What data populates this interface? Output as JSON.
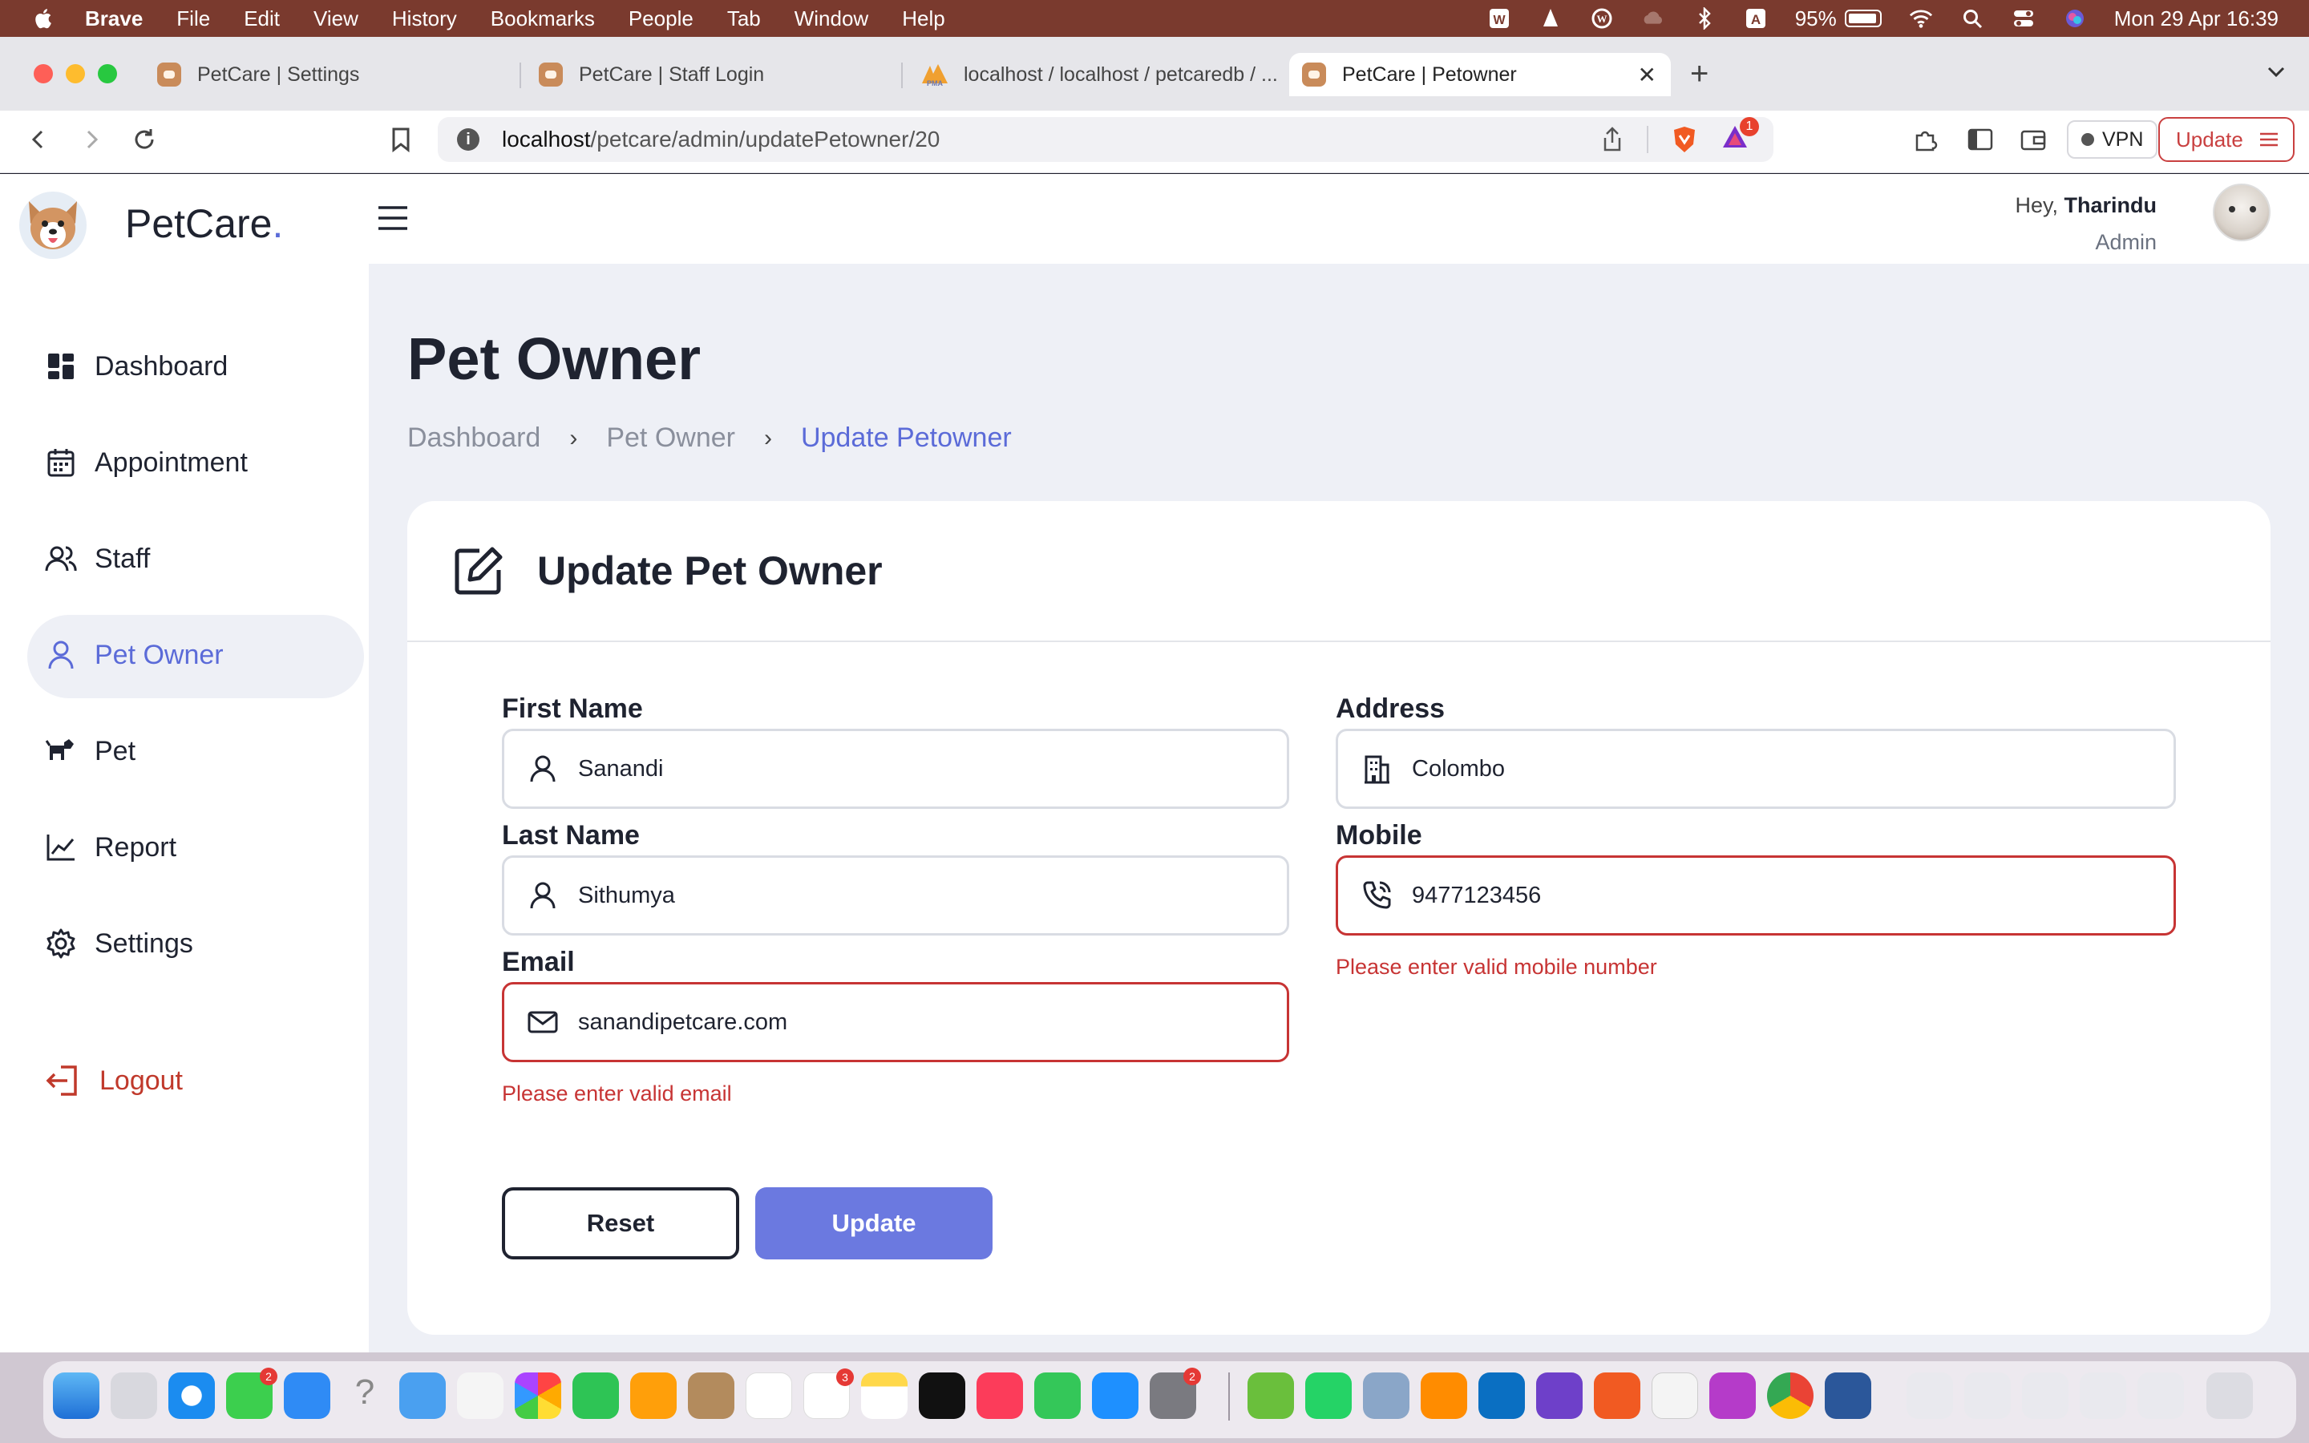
{
  "menubar": {
    "app": "Brave",
    "items": [
      "File",
      "Edit",
      "View",
      "History",
      "Bookmarks",
      "People",
      "Tab",
      "Window",
      "Help"
    ],
    "battery": "95%",
    "datetime": "Mon 29 Apr  16:39"
  },
  "browser": {
    "tabs": [
      {
        "title": "PetCare | Settings"
      },
      {
        "title": "PetCare | Staff Login"
      },
      {
        "title": "localhost / localhost / petcaredb / ..."
      },
      {
        "title": "PetCare | Petowner"
      }
    ],
    "url_host": "localhost",
    "url_path": "/petcare/admin/updatePetowner/20",
    "vpn_label": "VPN",
    "update_label": "Update",
    "notification_count": "1"
  },
  "app": {
    "brand": "PetCare",
    "brand_dot": ".",
    "user_greeting": "Hey,",
    "user_name": "Tharindu",
    "user_role": "Admin",
    "nav": [
      {
        "label": "Dashboard",
        "icon": "dashboard-icon"
      },
      {
        "label": "Appointment",
        "icon": "calendar-icon"
      },
      {
        "label": "Staff",
        "icon": "users-icon"
      },
      {
        "label": "Pet Owner",
        "icon": "user-icon"
      },
      {
        "label": "Pet",
        "icon": "pet-icon"
      },
      {
        "label": "Report",
        "icon": "chart-icon"
      },
      {
        "label": "Settings",
        "icon": "gear-icon"
      }
    ],
    "logout_label": "Logout"
  },
  "page": {
    "title": "Pet Owner",
    "breadcrumb": [
      "Dashboard",
      "Pet Owner",
      "Update Petowner"
    ],
    "card_title": "Update Pet Owner",
    "form": {
      "first_name_label": "First Name",
      "first_name_value": "Sanandi",
      "last_name_label": "Last Name",
      "last_name_value": "Sithumya",
      "email_label": "Email",
      "email_value": "sanandipetcare.com",
      "email_error": "Please enter valid email",
      "address_label": "Address",
      "address_value": "Colombo",
      "mobile_label": "Mobile",
      "mobile_value": "9477123456",
      "mobile_error": "Please enter valid mobile number"
    },
    "reset_label": "Reset",
    "update_label": "Update"
  },
  "colors": {
    "accent": "#5b6bd8",
    "button": "#6b79e0",
    "error": "#c73434",
    "page_bg": "#eef0f6"
  }
}
